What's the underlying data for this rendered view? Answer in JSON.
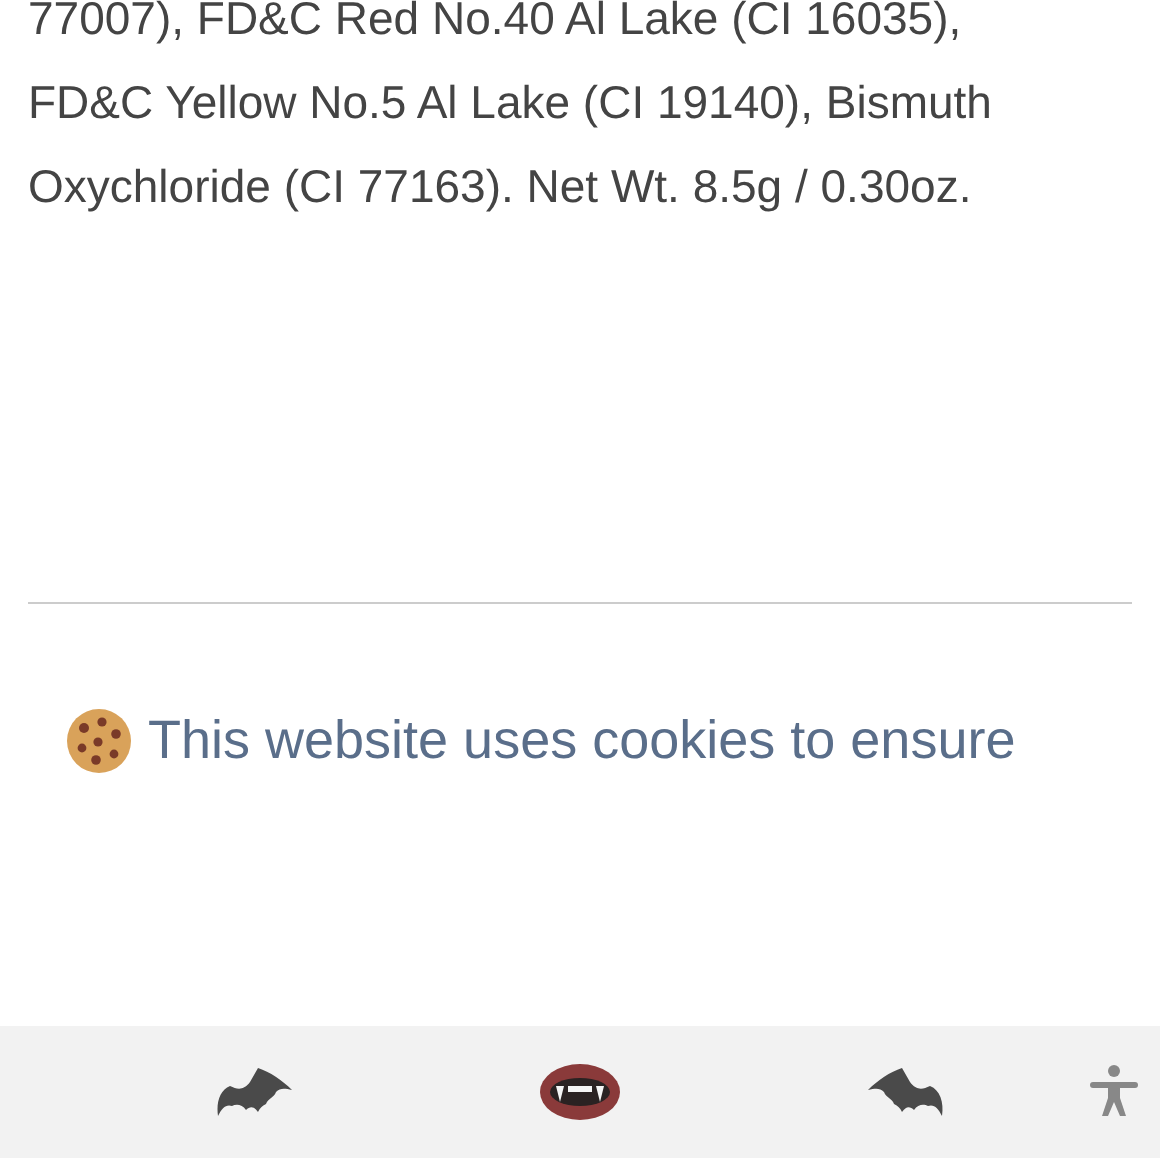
{
  "description_lines": [
    "77007), FD&C Red No.40 Al Lake (CI 16035),",
    "FD&C Yellow No.5 Al Lake (CI 19140), Bismuth",
    "Oxychloride (CI 77163). Net Wt. 8.5g / 0.30oz."
  ],
  "cookie_notice": {
    "text": "This website uses cookies to ensure"
  },
  "bottom_bar": {
    "items": [
      {
        "kind": "bat"
      },
      {
        "kind": "lips"
      },
      {
        "kind": "bat-flipped"
      },
      {
        "kind": "accessibility"
      }
    ]
  }
}
